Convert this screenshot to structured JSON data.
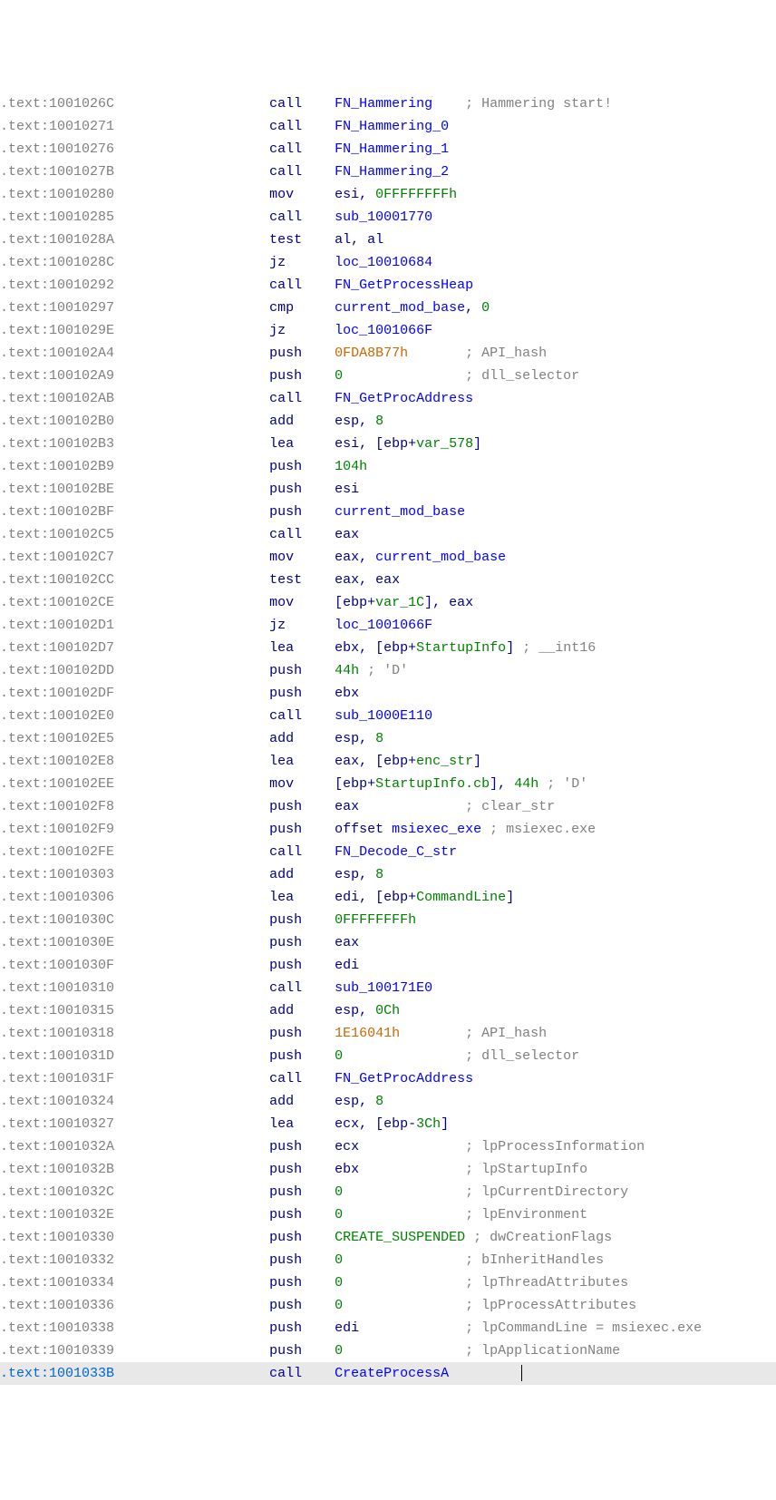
{
  "lines": [
    {
      "seg": ".text",
      "addr": "1001026C",
      "mn": "call",
      "op": [
        {
          "t": "func",
          "v": "FN_Hammering"
        }
      ],
      "cmt": "Hammering start!",
      "cmtPad": 4
    },
    {
      "seg": ".text",
      "addr": "10010271",
      "mn": "call",
      "op": [
        {
          "t": "func",
          "v": "FN_Hammering_0"
        }
      ]
    },
    {
      "seg": ".text",
      "addr": "10010276",
      "mn": "call",
      "op": [
        {
          "t": "func",
          "v": "FN_Hammering_1"
        }
      ]
    },
    {
      "seg": ".text",
      "addr": "1001027B",
      "mn": "call",
      "op": [
        {
          "t": "func",
          "v": "FN_Hammering_2"
        }
      ]
    },
    {
      "seg": ".text",
      "addr": "10010280",
      "mn": "mov",
      "op": [
        {
          "t": "reg",
          "v": "esi"
        },
        {
          "t": "punct",
          "v": ", "
        },
        {
          "t": "num",
          "v": "0FFFFFFFFh"
        }
      ]
    },
    {
      "seg": ".text",
      "addr": "10010285",
      "mn": "call",
      "op": [
        {
          "t": "loc",
          "v": "sub_10001770"
        }
      ]
    },
    {
      "seg": ".text",
      "addr": "1001028A",
      "mn": "test",
      "op": [
        {
          "t": "reg",
          "v": "al"
        },
        {
          "t": "punct",
          "v": ", "
        },
        {
          "t": "reg",
          "v": "al"
        }
      ]
    },
    {
      "seg": ".text",
      "addr": "1001028C",
      "mn": "jz",
      "op": [
        {
          "t": "loc",
          "v": "loc_10010684"
        }
      ]
    },
    {
      "seg": ".text",
      "addr": "10010292",
      "mn": "call",
      "op": [
        {
          "t": "func",
          "v": "FN_GetProcessHeap"
        }
      ]
    },
    {
      "seg": ".text",
      "addr": "10010297",
      "mn": "cmp",
      "op": [
        {
          "t": "loc",
          "v": "current_mod_base"
        },
        {
          "t": "punct",
          "v": ", "
        },
        {
          "t": "num",
          "v": "0"
        }
      ]
    },
    {
      "seg": ".text",
      "addr": "1001029E",
      "mn": "jz",
      "op": [
        {
          "t": "loc",
          "v": "loc_1001066F"
        }
      ]
    },
    {
      "seg": ".text",
      "addr": "100102A4",
      "mn": "push",
      "op": [
        {
          "t": "imm",
          "v": "0FDA8B77h"
        }
      ],
      "cmt": "API_hash",
      "cmtPad": 7
    },
    {
      "seg": ".text",
      "addr": "100102A9",
      "mn": "push",
      "op": [
        {
          "t": "num",
          "v": "0"
        }
      ],
      "cmt": "dll_selector",
      "cmtPad": 15
    },
    {
      "seg": ".text",
      "addr": "100102AB",
      "mn": "call",
      "op": [
        {
          "t": "func",
          "v": "FN_GetProcAddress"
        }
      ]
    },
    {
      "seg": ".text",
      "addr": "100102B0",
      "mn": "add",
      "op": [
        {
          "t": "reg",
          "v": "esp"
        },
        {
          "t": "punct",
          "v": ", "
        },
        {
          "t": "num",
          "v": "8"
        }
      ]
    },
    {
      "seg": ".text",
      "addr": "100102B3",
      "mn": "lea",
      "op": [
        {
          "t": "reg",
          "v": "esi"
        },
        {
          "t": "punct",
          "v": ", ["
        },
        {
          "t": "reg",
          "v": "ebp"
        },
        {
          "t": "punct",
          "v": "+"
        },
        {
          "t": "var",
          "v": "var_578"
        },
        {
          "t": "punct",
          "v": "]"
        }
      ]
    },
    {
      "seg": ".text",
      "addr": "100102B9",
      "mn": "push",
      "op": [
        {
          "t": "num",
          "v": "104h"
        }
      ]
    },
    {
      "seg": ".text",
      "addr": "100102BE",
      "mn": "push",
      "op": [
        {
          "t": "reg",
          "v": "esi"
        }
      ]
    },
    {
      "seg": ".text",
      "addr": "100102BF",
      "mn": "push",
      "op": [
        {
          "t": "loc",
          "v": "current_mod_base"
        }
      ]
    },
    {
      "seg": ".text",
      "addr": "100102C5",
      "mn": "call",
      "op": [
        {
          "t": "reg",
          "v": "eax"
        }
      ]
    },
    {
      "seg": ".text",
      "addr": "100102C7",
      "mn": "mov",
      "op": [
        {
          "t": "reg",
          "v": "eax"
        },
        {
          "t": "punct",
          "v": ", "
        },
        {
          "t": "loc",
          "v": "current_mod_base"
        }
      ]
    },
    {
      "seg": ".text",
      "addr": "100102CC",
      "mn": "test",
      "op": [
        {
          "t": "reg",
          "v": "eax"
        },
        {
          "t": "punct",
          "v": ", "
        },
        {
          "t": "reg",
          "v": "eax"
        }
      ]
    },
    {
      "seg": ".text",
      "addr": "100102CE",
      "mn": "mov",
      "op": [
        {
          "t": "punct",
          "v": "["
        },
        {
          "t": "reg",
          "v": "ebp"
        },
        {
          "t": "punct",
          "v": "+"
        },
        {
          "t": "var",
          "v": "var_1C"
        },
        {
          "t": "punct",
          "v": "], "
        },
        {
          "t": "reg",
          "v": "eax"
        }
      ]
    },
    {
      "seg": ".text",
      "addr": "100102D1",
      "mn": "jz",
      "op": [
        {
          "t": "loc",
          "v": "loc_1001066F"
        }
      ]
    },
    {
      "seg": ".text",
      "addr": "100102D7",
      "mn": "lea",
      "op": [
        {
          "t": "reg",
          "v": "ebx"
        },
        {
          "t": "punct",
          "v": ", ["
        },
        {
          "t": "reg",
          "v": "ebp"
        },
        {
          "t": "punct",
          "v": "+"
        },
        {
          "t": "var",
          "v": "StartupInfo"
        },
        {
          "t": "punct",
          "v": "]"
        }
      ],
      "cmt2": "__int16"
    },
    {
      "seg": ".text",
      "addr": "100102DD",
      "mn": "push",
      "op": [
        {
          "t": "num",
          "v": "44h"
        }
      ],
      "cmt2a": "'D'"
    },
    {
      "seg": ".text",
      "addr": "100102DF",
      "mn": "push",
      "op": [
        {
          "t": "reg",
          "v": "ebx"
        }
      ]
    },
    {
      "seg": ".text",
      "addr": "100102E0",
      "mn": "call",
      "op": [
        {
          "t": "loc",
          "v": "sub_1000E110"
        }
      ]
    },
    {
      "seg": ".text",
      "addr": "100102E5",
      "mn": "add",
      "op": [
        {
          "t": "reg",
          "v": "esp"
        },
        {
          "t": "punct",
          "v": ", "
        },
        {
          "t": "num",
          "v": "8"
        }
      ]
    },
    {
      "seg": ".text",
      "addr": "100102E8",
      "mn": "lea",
      "op": [
        {
          "t": "reg",
          "v": "eax"
        },
        {
          "t": "punct",
          "v": ", ["
        },
        {
          "t": "reg",
          "v": "ebp"
        },
        {
          "t": "punct",
          "v": "+"
        },
        {
          "t": "var",
          "v": "enc_str"
        },
        {
          "t": "punct",
          "v": "]"
        }
      ]
    },
    {
      "seg": ".text",
      "addr": "100102EE",
      "mn": "mov",
      "op": [
        {
          "t": "punct",
          "v": "["
        },
        {
          "t": "reg",
          "v": "ebp"
        },
        {
          "t": "punct",
          "v": "+"
        },
        {
          "t": "var",
          "v": "StartupInfo.cb"
        },
        {
          "t": "punct",
          "v": "], "
        },
        {
          "t": "num",
          "v": "44h"
        }
      ],
      "cmt2a": "'D'"
    },
    {
      "seg": ".text",
      "addr": "100102F8",
      "mn": "push",
      "op": [
        {
          "t": "reg",
          "v": "eax"
        }
      ],
      "cmt": "clear_str",
      "cmtPad": 13
    },
    {
      "seg": ".text",
      "addr": "100102F9",
      "mn": "push",
      "op": [
        {
          "t": "punct",
          "v": "offset "
        },
        {
          "t": "loc",
          "v": "msiexec_exe"
        }
      ],
      "cmt2": "msiexec.exe"
    },
    {
      "seg": ".text",
      "addr": "100102FE",
      "mn": "call",
      "op": [
        {
          "t": "func",
          "v": "FN_Decode_C_str"
        }
      ]
    },
    {
      "seg": ".text",
      "addr": "10010303",
      "mn": "add",
      "op": [
        {
          "t": "reg",
          "v": "esp"
        },
        {
          "t": "punct",
          "v": ", "
        },
        {
          "t": "num",
          "v": "8"
        }
      ]
    },
    {
      "seg": ".text",
      "addr": "10010306",
      "mn": "lea",
      "op": [
        {
          "t": "reg",
          "v": "edi"
        },
        {
          "t": "punct",
          "v": ", ["
        },
        {
          "t": "reg",
          "v": "ebp"
        },
        {
          "t": "punct",
          "v": "+"
        },
        {
          "t": "var",
          "v": "CommandLine"
        },
        {
          "t": "punct",
          "v": "]"
        }
      ]
    },
    {
      "seg": ".text",
      "addr": "1001030C",
      "mn": "push",
      "op": [
        {
          "t": "num",
          "v": "0FFFFFFFFh"
        }
      ]
    },
    {
      "seg": ".text",
      "addr": "1001030E",
      "mn": "push",
      "op": [
        {
          "t": "reg",
          "v": "eax"
        }
      ]
    },
    {
      "seg": ".text",
      "addr": "1001030F",
      "mn": "push",
      "op": [
        {
          "t": "reg",
          "v": "edi"
        }
      ]
    },
    {
      "seg": ".text",
      "addr": "10010310",
      "mn": "call",
      "op": [
        {
          "t": "loc",
          "v": "sub_100171E0"
        }
      ]
    },
    {
      "seg": ".text",
      "addr": "10010315",
      "mn": "add",
      "op": [
        {
          "t": "reg",
          "v": "esp"
        },
        {
          "t": "punct",
          "v": ", "
        },
        {
          "t": "num",
          "v": "0Ch"
        }
      ]
    },
    {
      "seg": ".text",
      "addr": "10010318",
      "mn": "push",
      "op": [
        {
          "t": "imm",
          "v": "1E16041h"
        }
      ],
      "cmt": "API_hash",
      "cmtPad": 8
    },
    {
      "seg": ".text",
      "addr": "1001031D",
      "mn": "push",
      "op": [
        {
          "t": "num",
          "v": "0"
        }
      ],
      "cmt": "dll_selector",
      "cmtPad": 15
    },
    {
      "seg": ".text",
      "addr": "1001031F",
      "mn": "call",
      "op": [
        {
          "t": "func",
          "v": "FN_GetProcAddress"
        }
      ]
    },
    {
      "seg": ".text",
      "addr": "10010324",
      "mn": "add",
      "op": [
        {
          "t": "reg",
          "v": "esp"
        },
        {
          "t": "punct",
          "v": ", "
        },
        {
          "t": "num",
          "v": "8"
        }
      ]
    },
    {
      "seg": ".text",
      "addr": "10010327",
      "mn": "lea",
      "op": [
        {
          "t": "reg",
          "v": "ecx"
        },
        {
          "t": "punct",
          "v": ", ["
        },
        {
          "t": "reg",
          "v": "ebp"
        },
        {
          "t": "punct",
          "v": "-"
        },
        {
          "t": "num",
          "v": "3Ch"
        },
        {
          "t": "punct",
          "v": "]"
        }
      ]
    },
    {
      "seg": ".text",
      "addr": "1001032A",
      "mn": "push",
      "op": [
        {
          "t": "reg",
          "v": "ecx"
        }
      ],
      "cmt": "lpProcessInformation",
      "cmtPad": 13
    },
    {
      "seg": ".text",
      "addr": "1001032B",
      "mn": "push",
      "op": [
        {
          "t": "reg",
          "v": "ebx"
        }
      ],
      "cmt": "lpStartupInfo",
      "cmtPad": 13
    },
    {
      "seg": ".text",
      "addr": "1001032C",
      "mn": "push",
      "op": [
        {
          "t": "num",
          "v": "0"
        }
      ],
      "cmt": "lpCurrentDirectory",
      "cmtPad": 15
    },
    {
      "seg": ".text",
      "addr": "1001032E",
      "mn": "push",
      "op": [
        {
          "t": "num",
          "v": "0"
        }
      ],
      "cmt": "lpEnvironment",
      "cmtPad": 15
    },
    {
      "seg": ".text",
      "addr": "10010330",
      "mn": "push",
      "op": [
        {
          "t": "const",
          "v": "CREATE_SUSPENDED"
        }
      ],
      "cmt2": "dwCreationFlags"
    },
    {
      "seg": ".text",
      "addr": "10010332",
      "mn": "push",
      "op": [
        {
          "t": "num",
          "v": "0"
        }
      ],
      "cmt": "bInheritHandles",
      "cmtPad": 15
    },
    {
      "seg": ".text",
      "addr": "10010334",
      "mn": "push",
      "op": [
        {
          "t": "num",
          "v": "0"
        }
      ],
      "cmt": "lpThreadAttributes",
      "cmtPad": 15
    },
    {
      "seg": ".text",
      "addr": "10010336",
      "mn": "push",
      "op": [
        {
          "t": "num",
          "v": "0"
        }
      ],
      "cmt": "lpProcessAttributes",
      "cmtPad": 15
    },
    {
      "seg": ".text",
      "addr": "10010338",
      "mn": "push",
      "op": [
        {
          "t": "reg",
          "v": "edi"
        }
      ],
      "cmt": "lpCommandLine = msiexec.exe",
      "cmtPad": 13
    },
    {
      "seg": ".text",
      "addr": "10010339",
      "mn": "push",
      "op": [
        {
          "t": "num",
          "v": "0"
        }
      ],
      "cmt": "lpApplicationName",
      "cmtPad": 15
    },
    {
      "seg": ".text",
      "addr": "1001033B",
      "mn": "call",
      "op": [
        {
          "t": "func",
          "v": "CreateProcessA"
        }
      ],
      "sel": true,
      "cursor": true
    }
  ]
}
